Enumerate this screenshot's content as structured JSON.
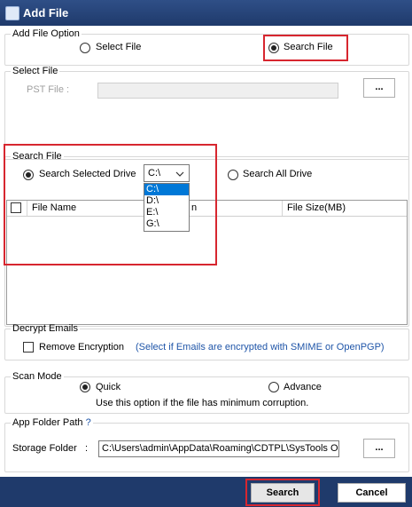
{
  "window": {
    "title": "Add File"
  },
  "add_file_option": {
    "legend": "Add File Option",
    "select_file_label": "Select File",
    "search_file_label": "Search File",
    "selected": "search_file"
  },
  "select_file": {
    "legend": "Select File",
    "pst_label": "PST File :",
    "pst_value": "",
    "browse_label": "..."
  },
  "search_file": {
    "legend": "Search File",
    "selected_drive_label": "Search Selected Drive",
    "all_drive_label": "Search All Drive",
    "drive_value": "C:\\",
    "drive_options": [
      "C:\\",
      "D:\\",
      "E:\\",
      "G:\\"
    ],
    "columns": {
      "file_name": "File Name",
      "partial": "n",
      "file_size": "File Size(MB)"
    }
  },
  "decrypt": {
    "legend": "Decrypt Emails",
    "remove_label": "Remove Encryption",
    "hint": "(Select if Emails are encrypted with SMIME or OpenPGP)"
  },
  "scan_mode": {
    "legend": "Scan Mode",
    "quick_label": "Quick",
    "advance_label": "Advance",
    "description": "Use this option if the file has minimum corruption.",
    "selected": "quick"
  },
  "app_folder": {
    "legend": "App Folder Path",
    "help": "?",
    "storage_label": "Storage Folder",
    "colon": ":",
    "storage_value": "C:\\Users\\admin\\AppData\\Roaming\\CDTPL\\SysTools Out",
    "browse_label": "..."
  },
  "footer": {
    "search_label": "Search",
    "cancel_label": "Cancel"
  },
  "colors": {
    "highlight": "#d7262f",
    "titlebar": "#1f3a6b",
    "link": "#1f55a8",
    "selection": "#0078d7"
  }
}
